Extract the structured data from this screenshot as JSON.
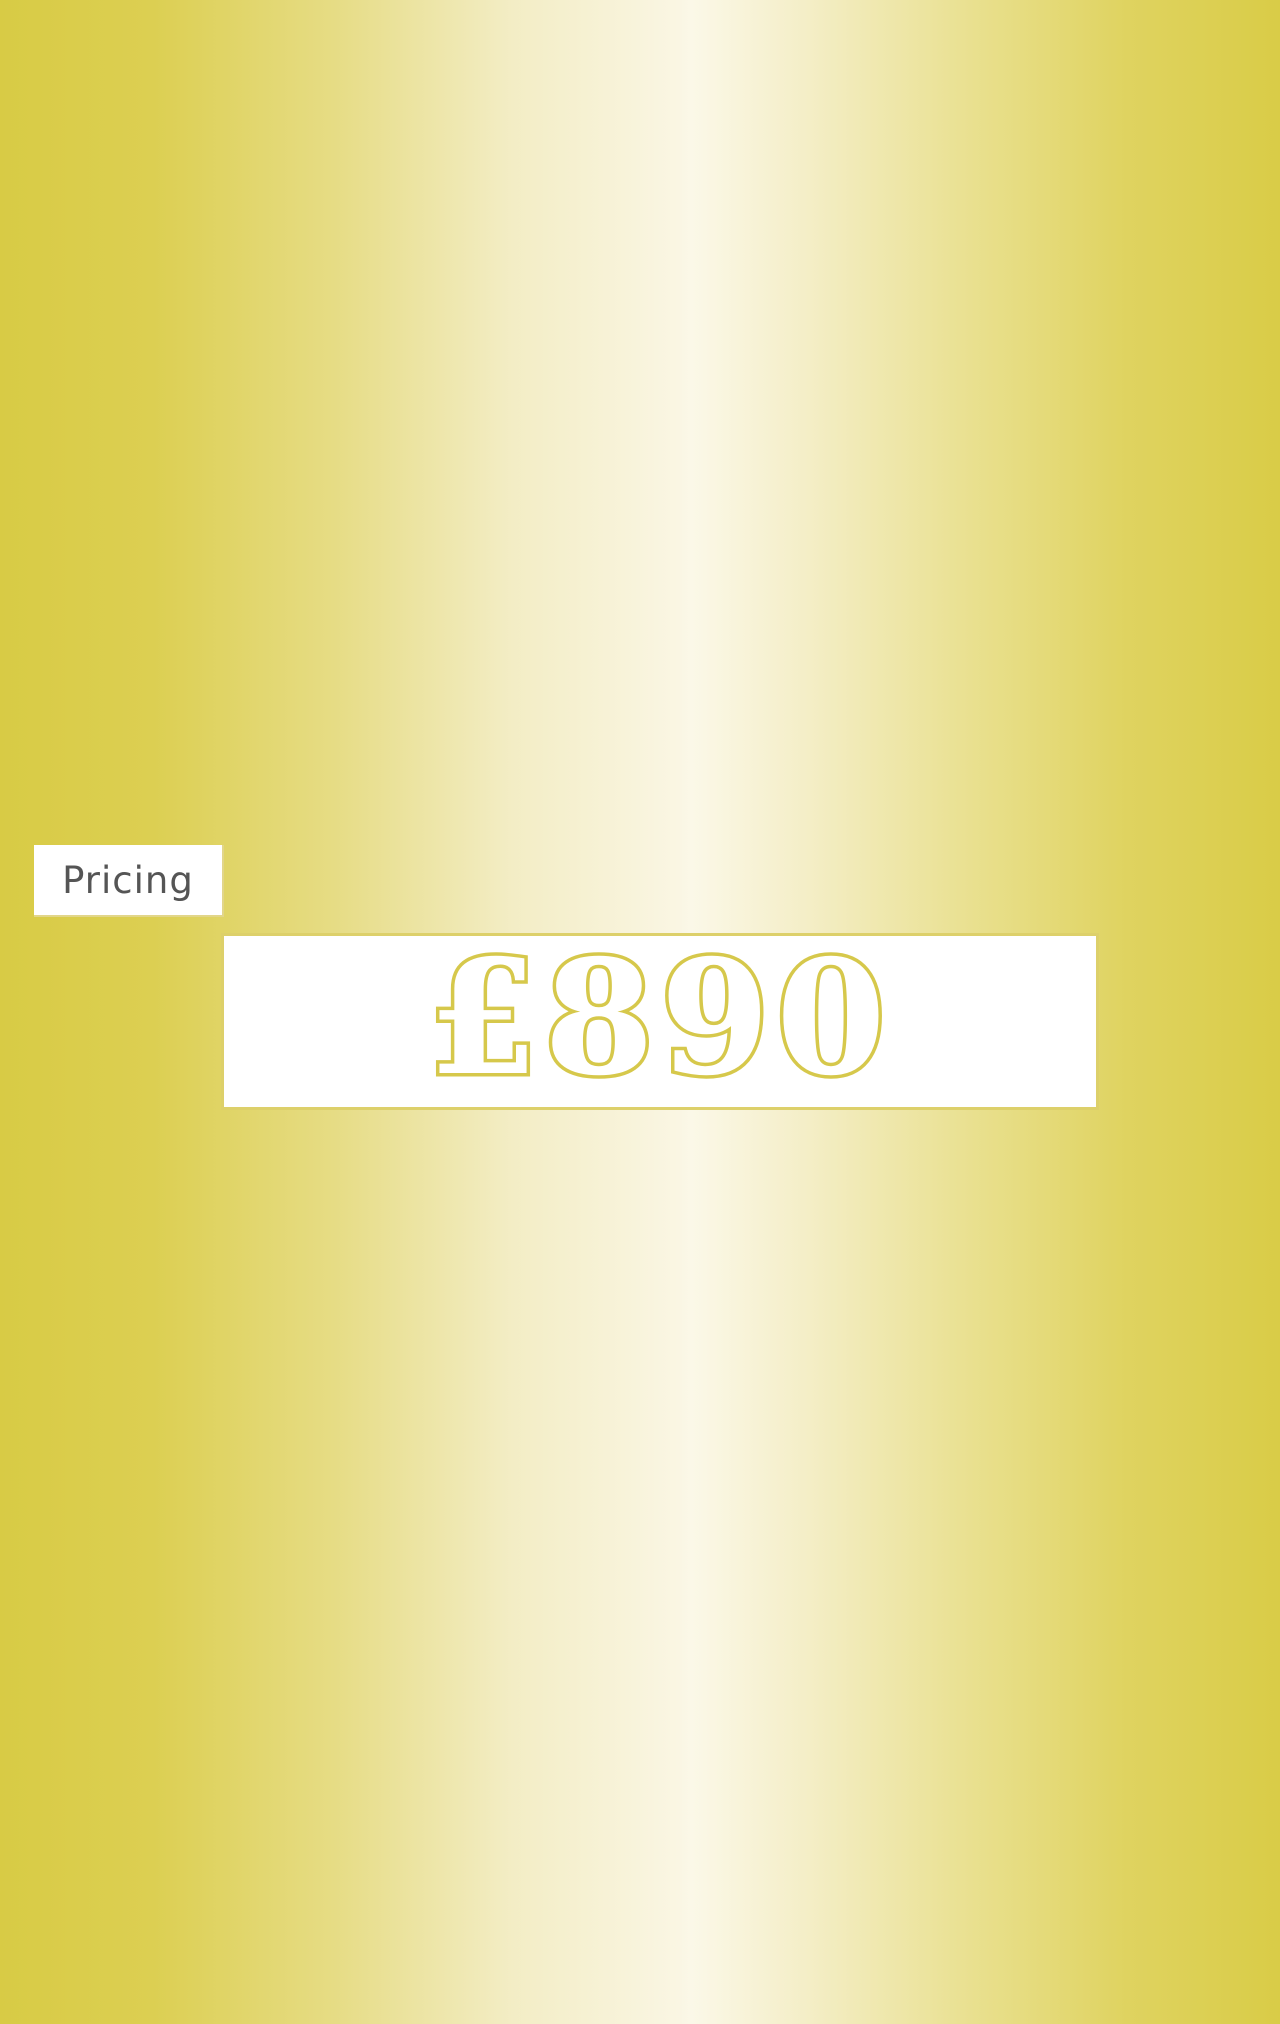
{
  "section": {
    "label": "Pricing"
  },
  "price": {
    "value": "£890"
  },
  "colors": {
    "accent": "#d6c84b",
    "background_edge": "#d8cb45",
    "background_center": "#fbf8e8"
  }
}
